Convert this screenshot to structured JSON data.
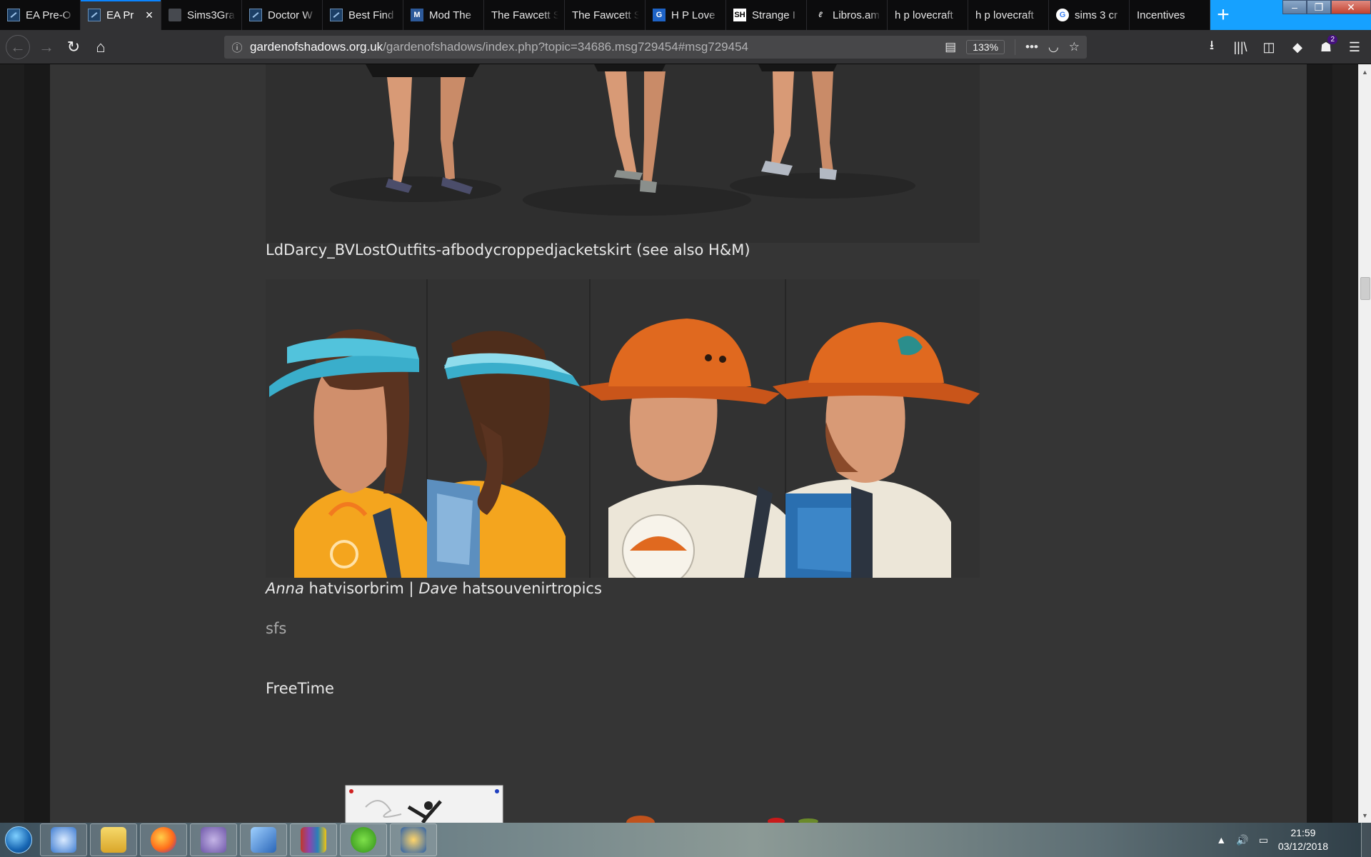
{
  "browser": {
    "tabs": [
      {
        "label": "EA Pre-O",
        "icon": "fav-ea",
        "active": false
      },
      {
        "label": "EA Pr",
        "icon": "fav-ea",
        "active": true
      },
      {
        "label": "Sims3Gra",
        "icon": "fav-doc",
        "active": false
      },
      {
        "label": "Doctor W",
        "icon": "fav-ea",
        "active": false
      },
      {
        "label": "Best Find",
        "icon": "fav-ea",
        "active": false
      },
      {
        "label": "Mod The",
        "icon": "fav-mod",
        "active": false
      },
      {
        "label": "The Fawcett S",
        "icon": "",
        "active": false
      },
      {
        "label": "The Fawcett S",
        "icon": "",
        "active": false
      },
      {
        "label": "H P Love",
        "icon": "fav-hp",
        "active": false
      },
      {
        "label": "Strange I",
        "icon": "fav-sh",
        "active": false
      },
      {
        "label": "Libros.am",
        "icon": "fav-libros",
        "active": false
      },
      {
        "label": "h p lovecraft",
        "icon": "",
        "active": false
      },
      {
        "label": "h p lovecraft",
        "icon": "",
        "active": false
      },
      {
        "label": "sims 3 cr",
        "icon": "fav-g",
        "active": false
      },
      {
        "label": "Incentives",
        "icon": "",
        "active": false
      }
    ],
    "favicon_text": {
      "mod": "M",
      "hp": "G",
      "sh": "SH",
      "libros": "ℓ",
      "g": "G"
    },
    "new_tab_glyph": "+",
    "window_controls": {
      "minimize": "‒",
      "maximize": "❐",
      "close": "✕"
    },
    "url": {
      "domain": "gardenofshadows.org.uk",
      "path": "/gardenofshadows/index.php?topic=34686.msg729454#msg729454"
    },
    "zoom": "133%",
    "notification_count": "2",
    "icons": {
      "back": "←",
      "forward": "→",
      "reload": "↻",
      "home": "⌂",
      "info": "ⓘ",
      "reader": "▤",
      "more": "•••",
      "pocket": "◡",
      "bookmark": "☆",
      "download": "⭳",
      "library": "|||\\",
      "sidebar": "◫",
      "extension": "◆",
      "account": "☗",
      "menu": "☰"
    }
  },
  "page": {
    "caption_outfit": "LdDarcy_BVLostOutfits-afbodycroppedjacketskirt (see also H&M)",
    "caption_hats": {
      "name1": "Anna",
      "item1": " hatvisorbrim | ",
      "name2": "Dave",
      "item2": " hatsouvenirtropics"
    },
    "caption_sfs": "sfs",
    "caption_freetime": "FreeTime"
  },
  "colors": {
    "visor": "#3aaecb",
    "orange_hat": "#e0691f",
    "shirt_yellow": "#f4a51e",
    "backpack_blue": "#2a6fb0",
    "skin": "#d89a76"
  },
  "taskbar": {
    "time": "21:59",
    "date": "03/12/2018",
    "tray_up": "▲",
    "tray_volume": "🔊",
    "tray_network": "▭"
  }
}
